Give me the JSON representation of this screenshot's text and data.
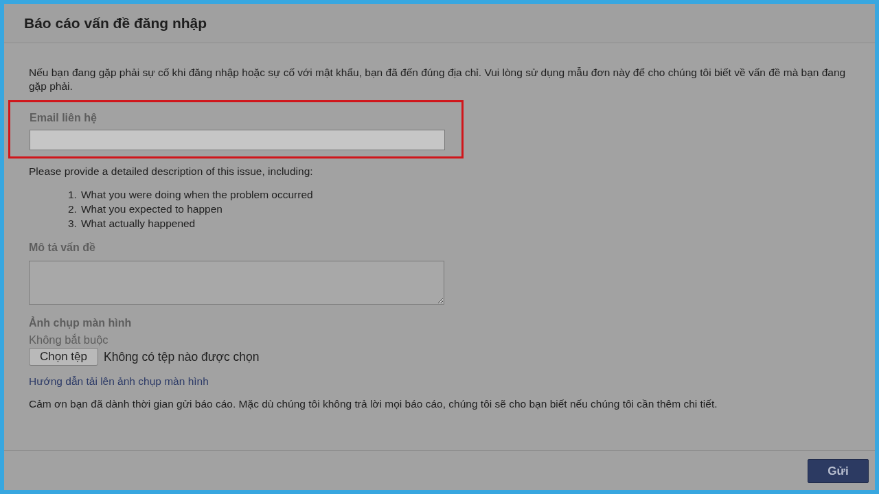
{
  "dialog": {
    "title": "Báo cáo vấn đề đăng nhập"
  },
  "intro": "Nếu bạn đang gặp phải sự cố khi đăng nhập hoặc sự cố với mật khẩu, bạn đã đến đúng địa chỉ. Vui lòng sử dụng mẫu đơn này để cho chúng tôi biết về vấn đề mà bạn đang gặp phải.",
  "email_field": {
    "label": "Email liên hệ",
    "highlighted": true
  },
  "instructions": "Please provide a detailed description of this issue, including:",
  "steps": [
    {
      "number": "1.",
      "text": "What you were doing when the problem occurred"
    },
    {
      "number": "2.",
      "text": "What you expected to happen"
    },
    {
      "number": "3.",
      "text": "What actually happened"
    }
  ],
  "description_field": {
    "label": "Mô tả vấn đề"
  },
  "screenshot": {
    "label": "Ảnh chụp màn hình",
    "hint": "Không bắt buộc",
    "button": "Chọn tệp",
    "file_status": "Không có tệp nào được chọn",
    "help_link": "Hướng dẫn tải lên ảnh chụp màn hình"
  },
  "thanks": "Cảm ơn bạn đã dành thời gian gửi báo cáo. Mặc dù chúng tôi không trả lời mọi báo cáo, chúng tôi sẽ cho bạn biết nếu chúng tôi cần thêm chi tiết.",
  "submit": "Gửi"
}
